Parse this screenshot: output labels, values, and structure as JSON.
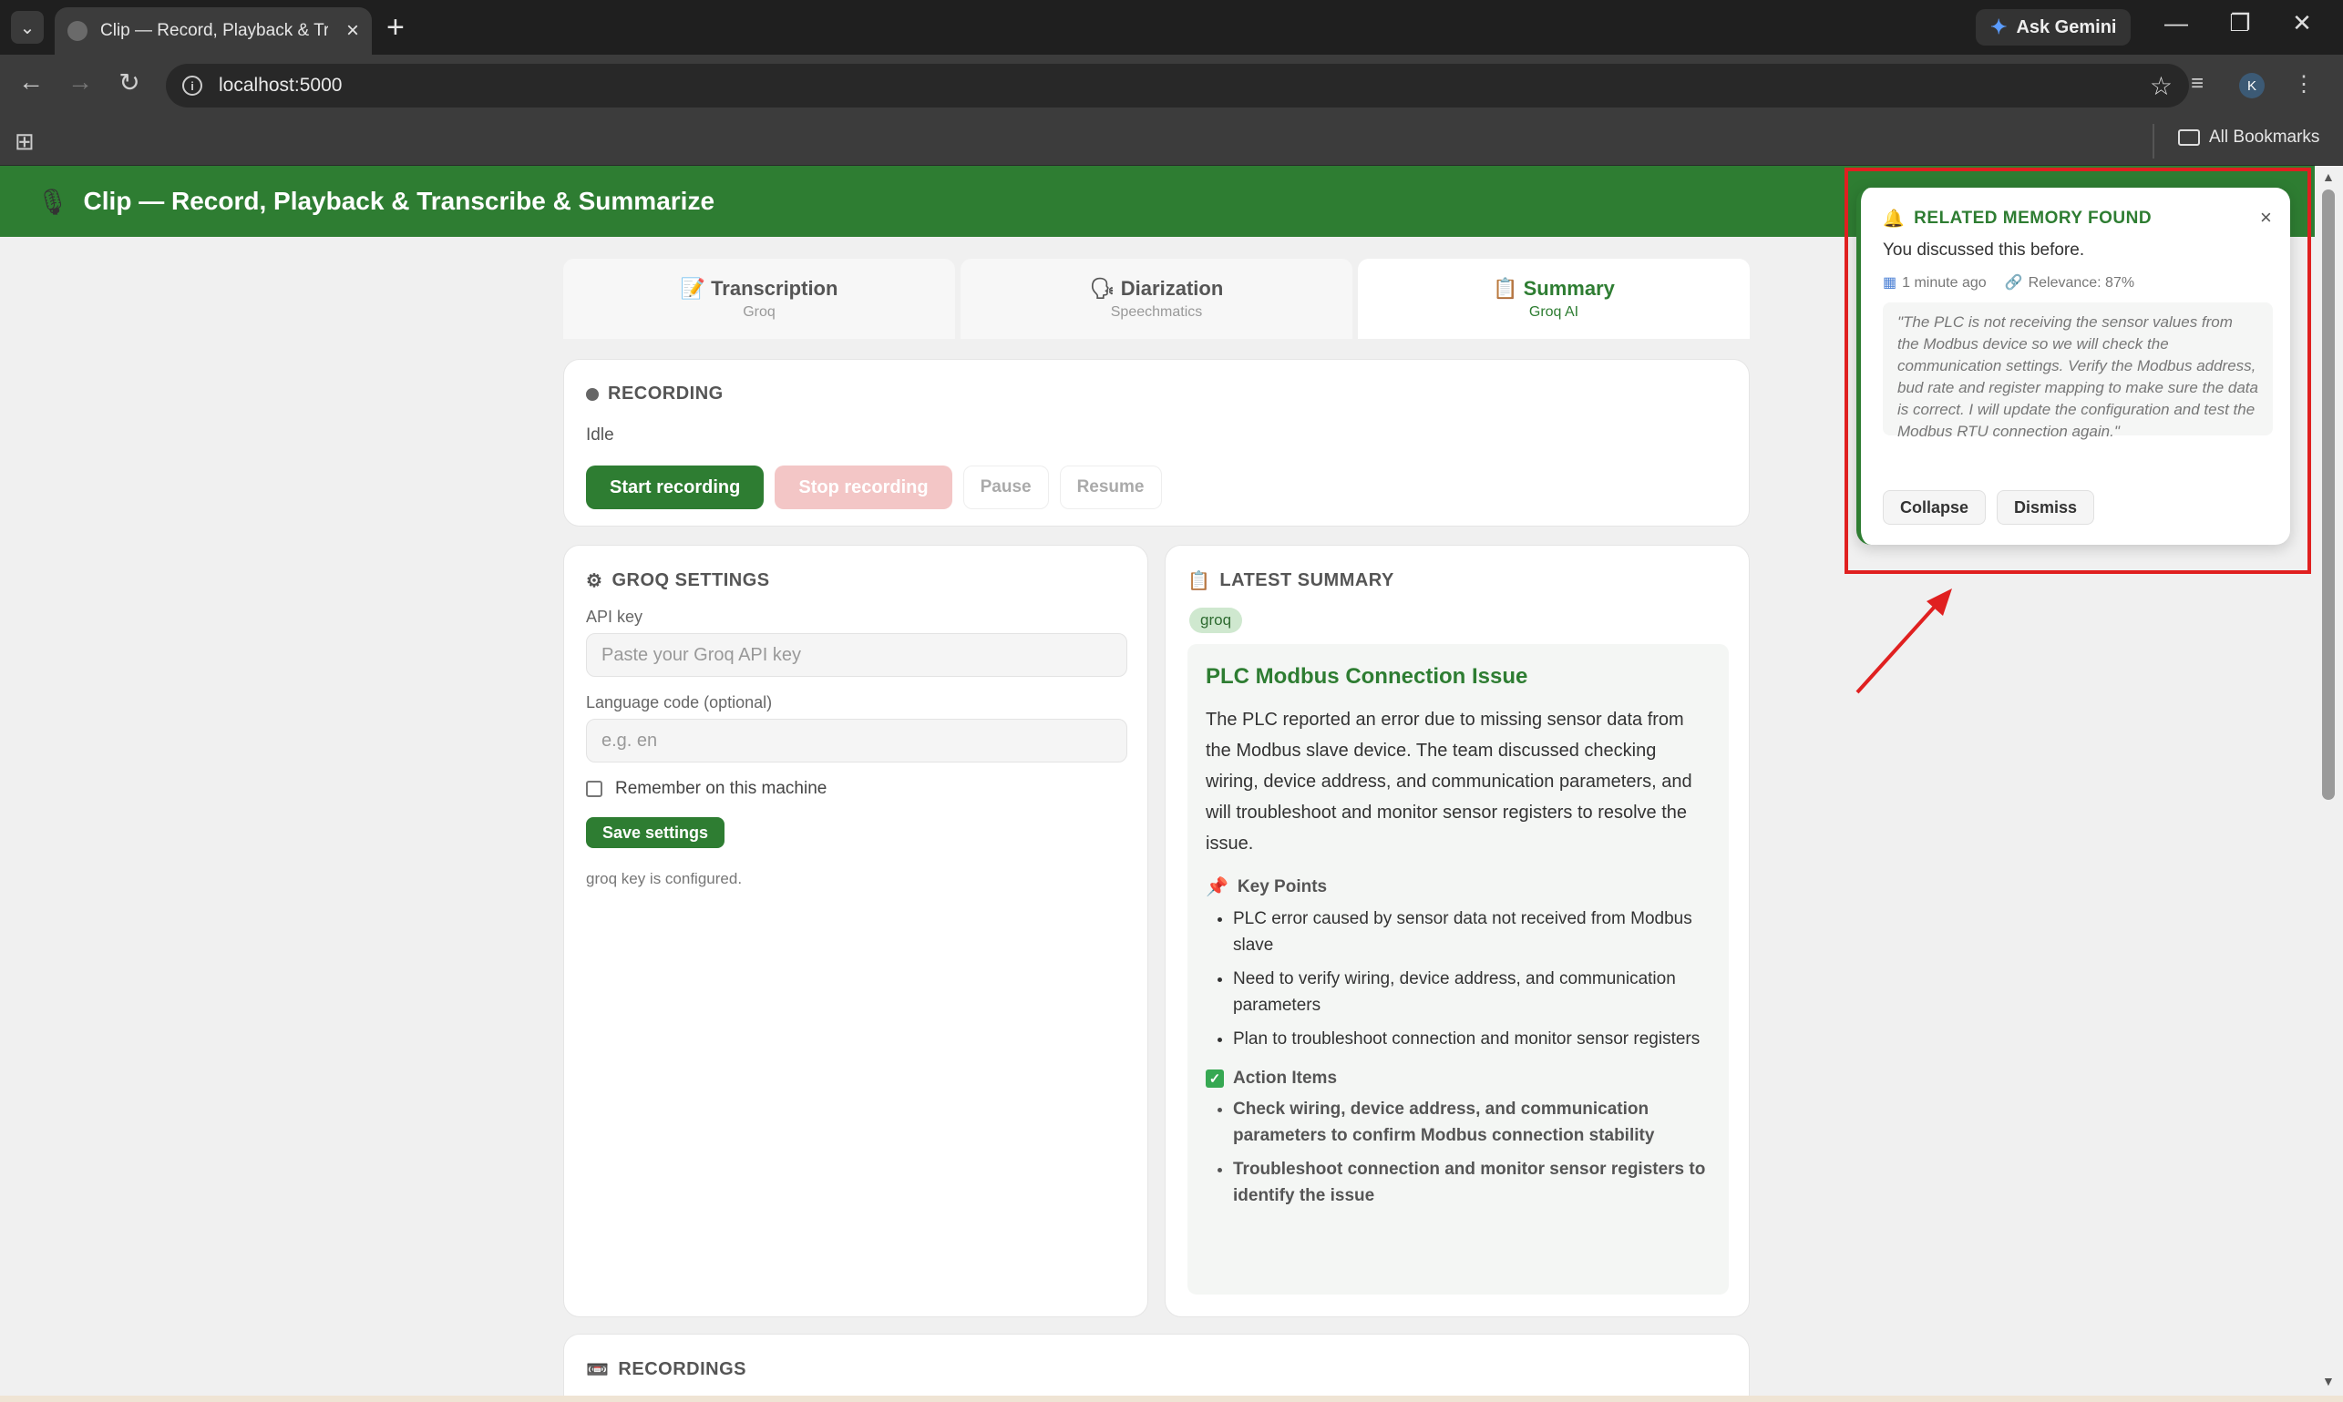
{
  "browser": {
    "tab_title": "Clip — Record, Playback & Transcribe & Summarize",
    "new_tab": "+",
    "ask_gemini": "Ask Gemini",
    "url": "localhost:5000",
    "profile_initial": "K",
    "all_bookmarks": "All Bookmarks"
  },
  "app": {
    "title": "Clip — Record, Playback & Transcribe & Summarize"
  },
  "tabs": [
    {
      "label": "Transcription",
      "sub": "Groq",
      "icon": "📝"
    },
    {
      "label": "Diarization",
      "sub": "Speechmatics",
      "icon": "🗣"
    },
    {
      "label": "Summary",
      "sub": "Groq AI",
      "icon": "📋"
    }
  ],
  "recording": {
    "title": "RECORDING",
    "status": "Idle",
    "start": "Start recording",
    "stop": "Stop recording",
    "pause": "Pause",
    "resume": "Resume"
  },
  "settings": {
    "title": "GROQ SETTINGS",
    "api_key_label": "API key",
    "api_key_placeholder": "Paste your Groq API key",
    "lang_label": "Language code (optional)",
    "lang_placeholder": "e.g. en",
    "remember": "Remember on this machine",
    "save": "Save settings",
    "note": "groq key is configured."
  },
  "summary": {
    "title": "LATEST SUMMARY",
    "badge": "groq",
    "heading": "PLC Modbus Connection Issue",
    "paragraph": "The PLC reported an error due to missing sensor data from the Modbus slave device. The team discussed checking wiring, device address, and communication parameters, and will troubleshoot and monitor sensor registers to resolve the issue.",
    "key_points_title": "Key Points",
    "key_points": [
      "PLC error caused by sensor data not received from Modbus slave",
      "Need to verify wiring, device address, and communication parameters",
      "Plan to troubleshoot connection and monitor sensor registers"
    ],
    "action_items_title": "Action Items",
    "action_items": [
      "Check wiring, device address, and communication parameters to confirm Modbus connection stability",
      "Troubleshoot connection and monitor sensor registers to identify the issue"
    ]
  },
  "recordings": {
    "title": "RECORDINGS"
  },
  "notification": {
    "title": "RELATED MEMORY FOUND",
    "message": "You discussed this before.",
    "time": "1 minute ago",
    "relevance": "Relevance: 87%",
    "quote": "\"The PLC is not receiving the sensor values from the Modbus device so we will check the communication settings. Verify the Modbus address, bud rate and register mapping to make sure the data is correct. I will update the configuration and test the Modbus RTU connection again.\"",
    "collapse": "Collapse",
    "dismiss": "Dismiss",
    "close": "×"
  },
  "colors": {
    "brand": "#2e7d32",
    "annotation": "#e02020"
  }
}
